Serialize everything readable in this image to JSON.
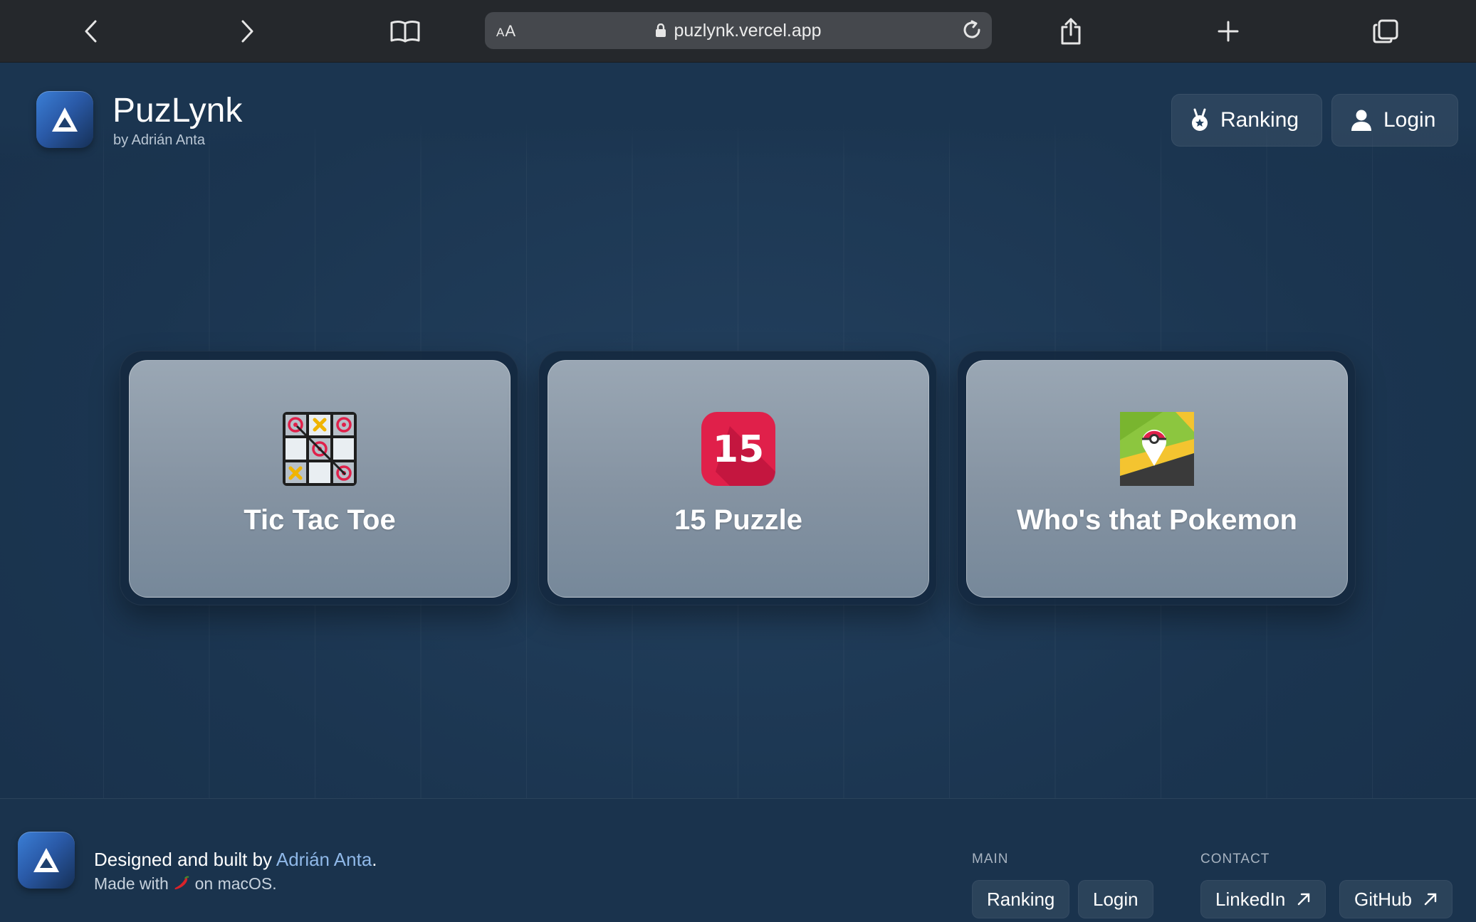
{
  "browser": {
    "url": "puzlynk.vercel.app",
    "text_size_label": "AA"
  },
  "header": {
    "brand_name": "PuzLynk",
    "brand_subtitle": "by Adrián Anta",
    "nav": [
      {
        "label": "Ranking",
        "icon": "medal-icon"
      },
      {
        "label": "Login",
        "icon": "user-icon"
      }
    ]
  },
  "games": [
    {
      "title": "Tic Tac Toe",
      "icon": "tic-tac-toe-icon"
    },
    {
      "title": "15 Puzzle",
      "icon": "fifteen-puzzle-icon",
      "icon_text": "15"
    },
    {
      "title": "Who's that Pokemon",
      "icon": "pokemon-map-icon"
    }
  ],
  "footer": {
    "designed_prefix": "Designed and built by ",
    "author": "Adrián Anta",
    "designed_suffix": ".",
    "made_prefix": "Made with",
    "made_suffix": "on macOS.",
    "main_heading": "MAIN",
    "main_links": [
      "Ranking",
      "Login"
    ],
    "contact_heading": "CONTACT",
    "contact_links": [
      "LinkedIn",
      "GitHub"
    ]
  },
  "colors": {
    "background": "#1b3550",
    "card": "#8593a2",
    "link": "#8fb8e8",
    "puzzle_red": "#e0204a"
  }
}
